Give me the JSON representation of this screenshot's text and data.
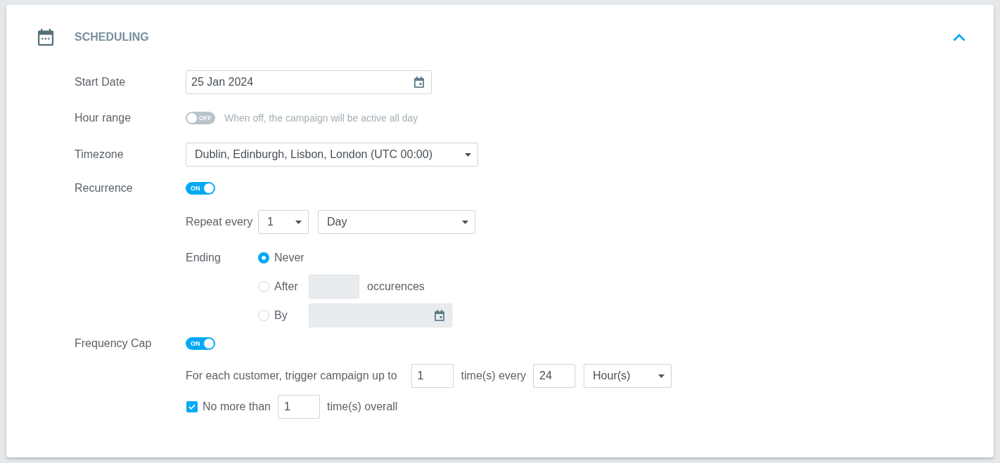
{
  "section": {
    "title": "SCHEDULING",
    "expanded": true
  },
  "start_date": {
    "label": "Start Date",
    "value": "25 Jan 2024"
  },
  "hour_range": {
    "label": "Hour range",
    "on": false,
    "switch_text": "OFF",
    "hint": "When off, the campaign will be active all day"
  },
  "timezone": {
    "label": "Timezone",
    "value": "Dublin, Edinburgh, Lisbon, London (UTC 00:00)"
  },
  "recurrence": {
    "label": "Recurrence",
    "on": true,
    "switch_text": "ON",
    "repeat": {
      "label": "Repeat every",
      "count": "1",
      "unit": "Day"
    },
    "ending": {
      "label": "Ending",
      "options": [
        {
          "kind": "plain",
          "label": "Never",
          "selected": true
        },
        {
          "kind": "count",
          "label": "After",
          "selected": false,
          "disabled": true,
          "suffix": "occurences"
        },
        {
          "kind": "date",
          "label": "By",
          "selected": false,
          "disabled": true
        }
      ]
    }
  },
  "frequency_cap": {
    "label": "Frequency Cap",
    "on": true,
    "switch_text": "ON",
    "rule": {
      "lead": "For each customer, trigger campaign up to",
      "times": "1",
      "middle": "time(s) every",
      "period": "24",
      "unit": "Hour(s)"
    },
    "limit": {
      "checked": true,
      "label": "No more than",
      "value": "1",
      "suffix": "time(s) overall"
    }
  }
}
